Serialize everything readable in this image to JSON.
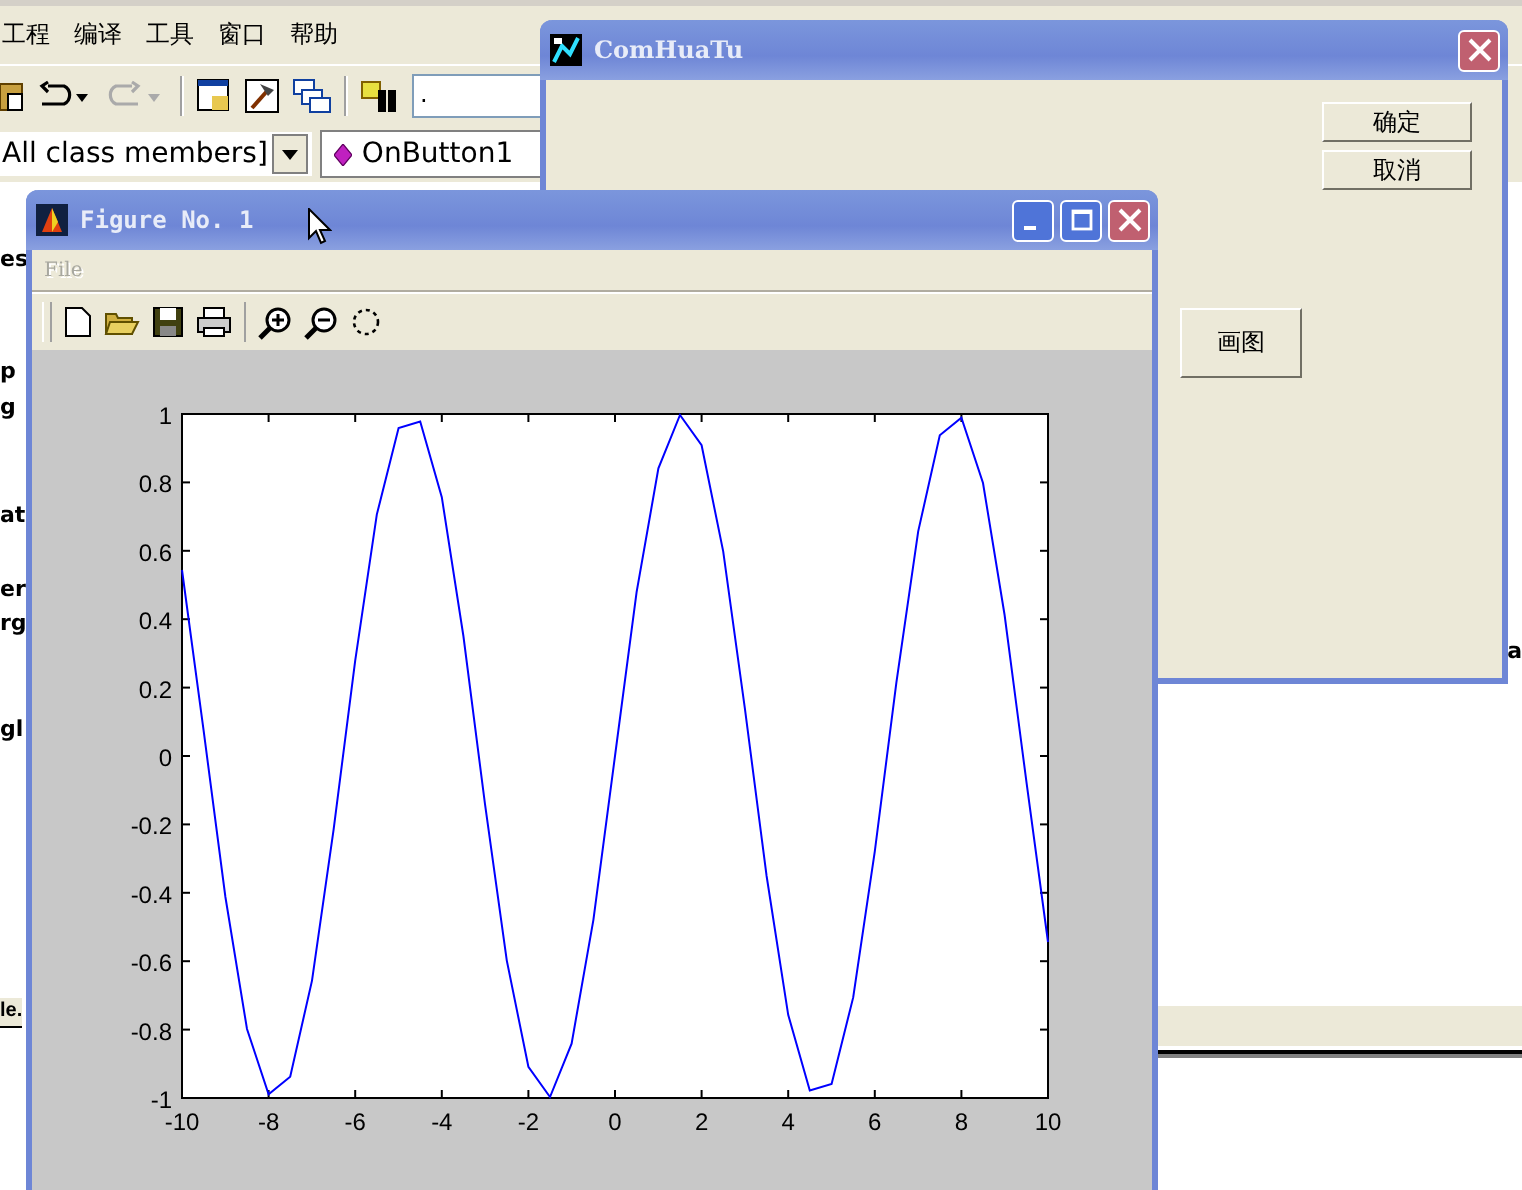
{
  "ide": {
    "menu": [
      "工程",
      "编译",
      "工具",
      "窗口",
      "帮助"
    ],
    "class_filter": "All class members]",
    "member": "OnButton1",
    "find_field": ".",
    "pane_fragments": [
      "es",
      "p",
      "g",
      "at",
      "er",
      "rg",
      "gl"
    ],
    "tab_fragment": "le.",
    "right_fragment": "a"
  },
  "dialog": {
    "title": "ComHuaTu",
    "buttons": [
      "确定",
      "取消"
    ],
    "draw_button": "画图"
  },
  "figure": {
    "title": "Figure No. 1",
    "menu": [
      {
        "label": "File",
        "disabled": true
      }
    ],
    "chart_data": {
      "type": "line",
      "xlim": [
        -10,
        10
      ],
      "ylim": [
        -1,
        1
      ],
      "xticks": [
        -10,
        -8,
        -6,
        -4,
        -2,
        0,
        2,
        4,
        6,
        8,
        10
      ],
      "yticks": [
        -1,
        -0.8,
        -0.6,
        -0.4,
        -0.2,
        0,
        0.2,
        0.4,
        0.6,
        0.8,
        1
      ],
      "x": [
        -10,
        -9.5,
        -9,
        -8.5,
        -8,
        -7.5,
        -7,
        -6.5,
        -6,
        -5.5,
        -5,
        -4.5,
        -4,
        -3.5,
        -3,
        -2.5,
        -2,
        -1.5,
        -1,
        -0.5,
        0,
        0.5,
        1,
        1.5,
        2,
        2.5,
        3,
        3.5,
        4,
        4.5,
        5,
        5.5,
        6,
        6.5,
        7,
        7.5,
        8,
        8.5,
        9,
        9.5,
        10
      ],
      "series": [
        {
          "color": "#0000ff",
          "values": [
            0.544,
            0.075,
            -0.412,
            -0.798,
            -0.989,
            -0.938,
            -0.657,
            -0.215,
            0.279,
            0.706,
            0.959,
            0.978,
            0.757,
            0.351,
            -0.141,
            -0.598,
            -0.909,
            -0.997,
            -0.841,
            -0.479,
            0,
            0.479,
            0.841,
            0.997,
            0.909,
            0.598,
            0.141,
            -0.351,
            -0.757,
            -0.978,
            -0.959,
            -0.706,
            -0.279,
            0.215,
            0.657,
            0.938,
            0.989,
            0.798,
            0.412,
            -0.075,
            -0.544
          ]
        }
      ]
    }
  }
}
